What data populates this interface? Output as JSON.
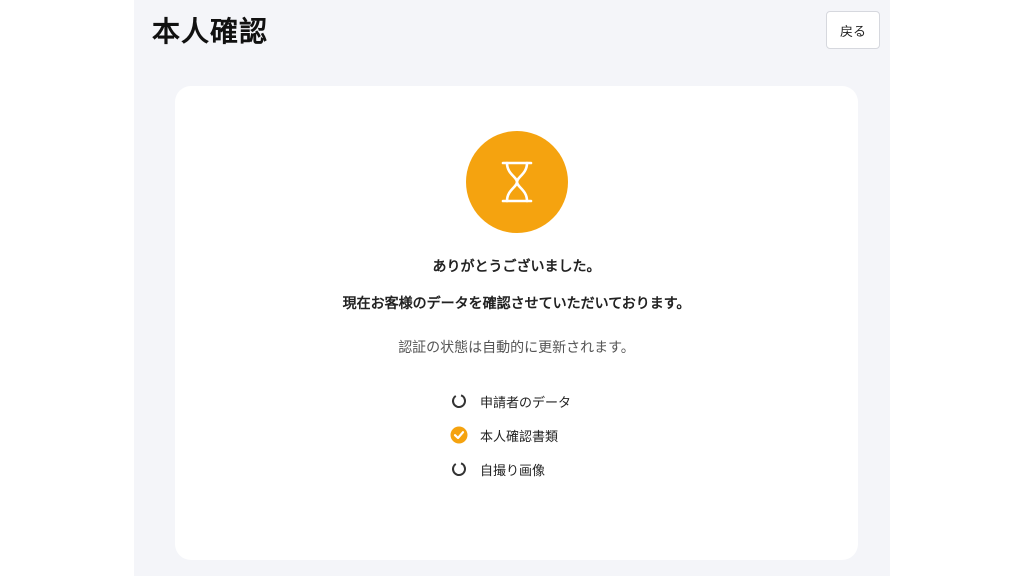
{
  "header": {
    "title": "本人確認",
    "back_label": "戻る"
  },
  "status": {
    "icon": "hourglass-icon",
    "color": "#f5a30f",
    "thanks": "ありがとうございました。",
    "checking": "現在お客様のデータを確認させていただいております。",
    "auto_update": "認証の状態は自動的に更新されます。"
  },
  "steps": [
    {
      "label": "申請者のデータ",
      "state": "pending",
      "icon": "loading-ring-icon"
    },
    {
      "label": "本人確認書類",
      "state": "done",
      "icon": "check-circle-icon"
    },
    {
      "label": "自撮り画像",
      "state": "pending",
      "icon": "loading-ring-icon"
    }
  ],
  "colors": {
    "accent": "#f5a30f",
    "background": "#f4f5f9",
    "card": "#ffffff"
  }
}
